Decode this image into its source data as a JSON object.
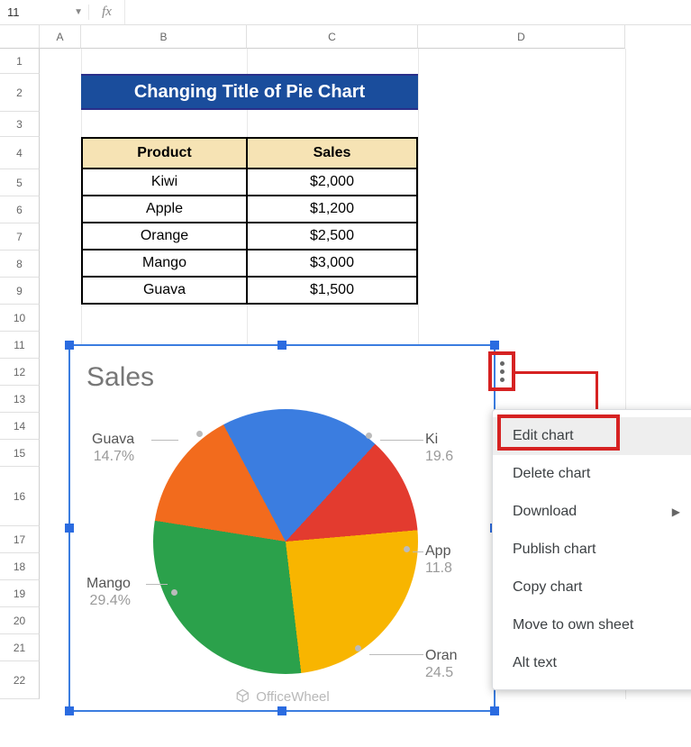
{
  "formula_bar": {
    "cell_ref": "11",
    "fx": "fx"
  },
  "columns": [
    "A",
    "B",
    "C",
    "D"
  ],
  "rows": [
    "1",
    "2",
    "3",
    "4",
    "5",
    "6",
    "7",
    "8",
    "9",
    "10",
    "11",
    "12",
    "13",
    "14",
    "15",
    "16",
    "17",
    "18",
    "19",
    "20",
    "21",
    "22"
  ],
  "title_banner": "Changing Title of Pie Chart",
  "table": {
    "headers": [
      "Product",
      "Sales"
    ],
    "rows": [
      [
        "Kiwi",
        "$2,000"
      ],
      [
        "Apple",
        "$1,200"
      ],
      [
        "Orange",
        "$2,500"
      ],
      [
        "Mango",
        "$3,000"
      ],
      [
        "Guava",
        "$1,500"
      ]
    ]
  },
  "chart": {
    "title": "Sales",
    "labels": {
      "guava": {
        "name": "Guava",
        "pct": "14.7%"
      },
      "kiwi": {
        "name": "Ki",
        "pct": "19.6"
      },
      "apple": {
        "name": "App",
        "pct": "11.8"
      },
      "orange": {
        "name": "Oran",
        "pct": "24.5"
      },
      "mango": {
        "name": "Mango",
        "pct": "29.4%"
      }
    },
    "watermark": "OfficeWheel"
  },
  "context_menu": {
    "items": [
      "Edit chart",
      "Delete chart",
      "Download",
      "Publish chart",
      "Copy chart",
      "Move to own sheet",
      "Alt text"
    ],
    "submenu_index": 2
  },
  "chart_data": {
    "type": "pie",
    "title": "Sales",
    "series": [
      {
        "name": "Kiwi",
        "value": 2000,
        "pct": 19.6,
        "color": "#3b7de0"
      },
      {
        "name": "Apple",
        "value": 1200,
        "pct": 11.8,
        "color": "#e33b2f"
      },
      {
        "name": "Orange",
        "value": 2500,
        "pct": 24.5,
        "color": "#f8b500"
      },
      {
        "name": "Mango",
        "value": 3000,
        "pct": 29.4,
        "color": "#2ba14b"
      },
      {
        "name": "Guava",
        "value": 1500,
        "pct": 14.7,
        "color": "#f26b1d"
      }
    ]
  }
}
